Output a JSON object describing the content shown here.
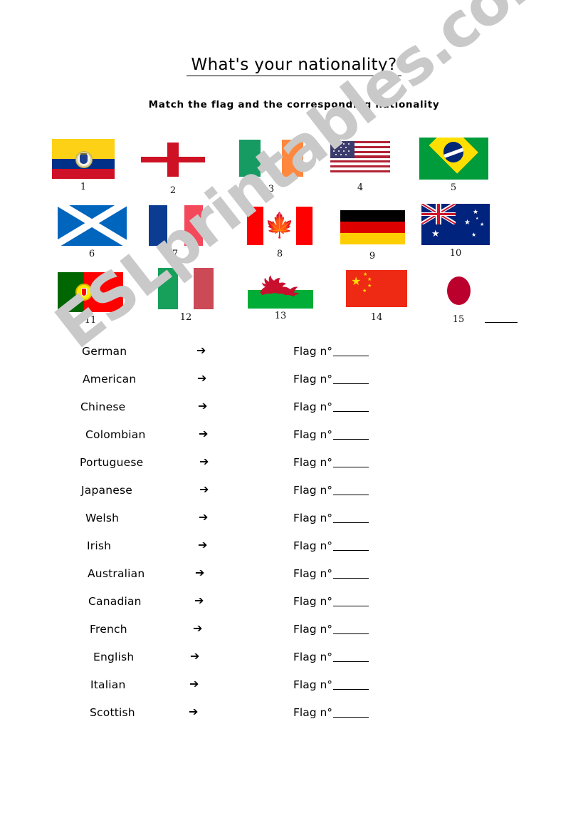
{
  "worksheet": {
    "title": "What's your nationality?",
    "instruction": "Match the flag and the corresponding nationality",
    "watermark": "ESLprintables.com",
    "answer_prefix": "Flag n°",
    "arrow_glyph": "➔"
  },
  "flags": [
    {
      "number": "1",
      "country": "Colombia",
      "icon": "flag-colombia"
    },
    {
      "number": "2",
      "country": "England",
      "icon": "flag-england"
    },
    {
      "number": "3",
      "country": "Ireland",
      "icon": "flag-ireland"
    },
    {
      "number": "4",
      "country": "United States",
      "icon": "flag-usa"
    },
    {
      "number": "5",
      "country": "Brazil",
      "icon": "flag-brazil"
    },
    {
      "number": "6",
      "country": "Scotland",
      "icon": "flag-scotland"
    },
    {
      "number": "7",
      "country": "France",
      "icon": "flag-france"
    },
    {
      "number": "8",
      "country": "Canada",
      "icon": "flag-canada"
    },
    {
      "number": "9",
      "country": "Germany",
      "icon": "flag-germany"
    },
    {
      "number": "10",
      "country": "Australia",
      "icon": "flag-australia"
    },
    {
      "number": "11",
      "country": "Portugal",
      "icon": "flag-portugal"
    },
    {
      "number": "12",
      "country": "Italy",
      "icon": "flag-italy"
    },
    {
      "number": "13",
      "country": "Wales",
      "icon": "flag-wales"
    },
    {
      "number": "14",
      "country": "China",
      "icon": "flag-china"
    },
    {
      "number": "15",
      "country": "Japan",
      "icon": "flag-japan"
    }
  ],
  "nationalities": [
    {
      "label": "German",
      "answer": ""
    },
    {
      "label": "American",
      "answer": ""
    },
    {
      "label": "Chinese",
      "answer": ""
    },
    {
      "label": "Colombian",
      "answer": ""
    },
    {
      "label": "Portuguese",
      "answer": ""
    },
    {
      "label": "Japanese",
      "answer": ""
    },
    {
      "label": "Welsh",
      "answer": ""
    },
    {
      "label": "Irish",
      "answer": ""
    },
    {
      "label": "Australian",
      "answer": ""
    },
    {
      "label": "Canadian",
      "answer": ""
    },
    {
      "label": "French",
      "answer": ""
    },
    {
      "label": "English",
      "answer": ""
    },
    {
      "label": "Italian",
      "answer": ""
    },
    {
      "label": "Scottish",
      "answer": ""
    }
  ],
  "colors": {
    "watermark": "#c9c9c9",
    "ink": "#000000",
    "paper": "#ffffff"
  }
}
